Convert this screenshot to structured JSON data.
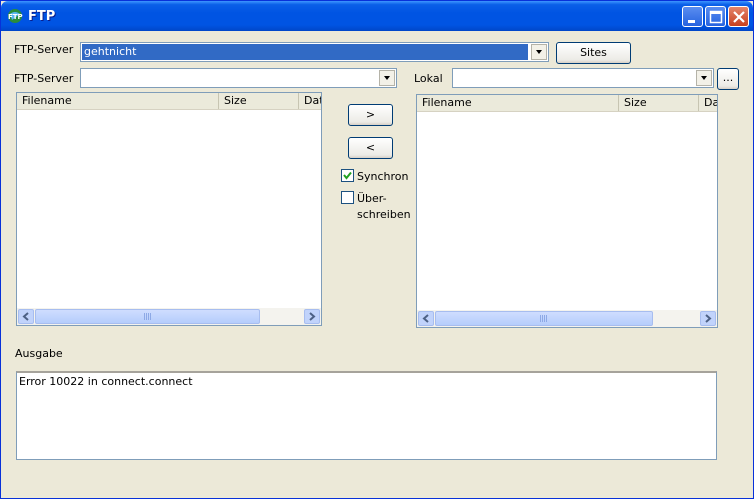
{
  "window": {
    "title": "FTP"
  },
  "server_row": {
    "label": "FTP-Server",
    "selected_value": "gehtnicht",
    "sites_button": "Sites"
  },
  "remote_path_row": {
    "label": "FTP-Server",
    "value": ""
  },
  "local_row": {
    "label": "Lokal",
    "value": "",
    "browse_button": "..."
  },
  "remote_list": {
    "columns": [
      "Filename",
      "Size",
      "Dat"
    ],
    "rows": []
  },
  "local_list": {
    "columns": [
      "Filename",
      "Size",
      "Da"
    ],
    "rows": []
  },
  "transfer": {
    "upload_label": ">",
    "download_label": "<"
  },
  "options": {
    "synchron": {
      "label": "Synchron",
      "checked": true
    },
    "overwrite": {
      "label_line1": "Über-",
      "label_line2": "schreiben",
      "checked": false
    }
  },
  "output": {
    "label": "Ausgabe",
    "text": "Error 10022 in connect.connect"
  },
  "colors": {
    "titlebar": "#0054E3",
    "selection": "#316AC5",
    "window_bg": "#ECE9D8"
  }
}
